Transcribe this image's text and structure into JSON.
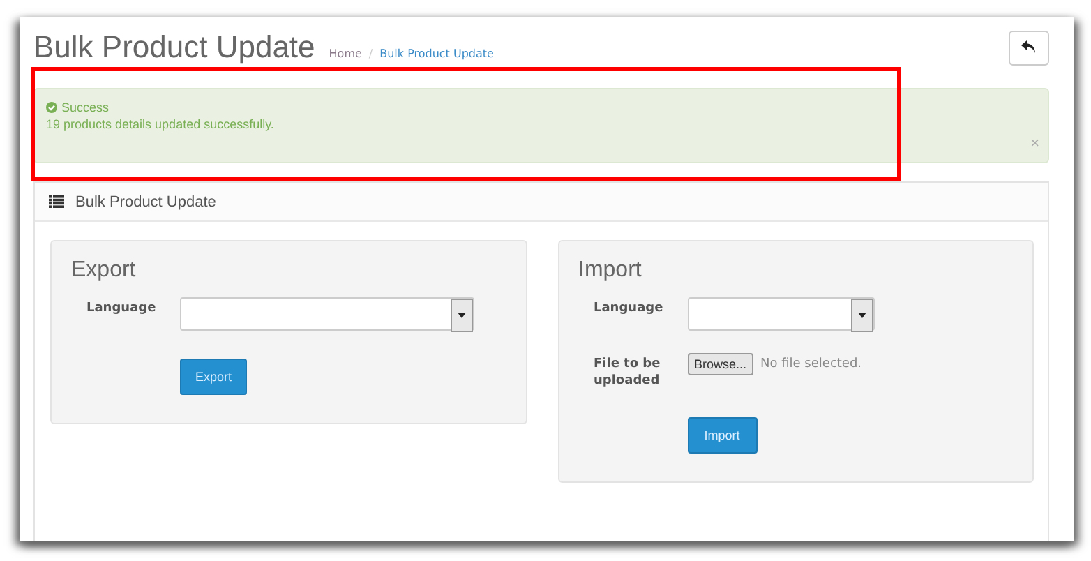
{
  "header": {
    "title": "Bulk Product Update",
    "separator": "/",
    "breadcrumbs": [
      {
        "label": "Home",
        "current": false
      },
      {
        "label": "Bulk Product Update",
        "current": true
      }
    ]
  },
  "alert": {
    "title": "Success",
    "message": "19 products details updated successfully.",
    "close": "×",
    "highlighted": true
  },
  "panel": {
    "title": "Bulk Product Update"
  },
  "export": {
    "title": "Export",
    "language_label": "Language",
    "button": "Export"
  },
  "import": {
    "title": "Import",
    "language_label": "Language",
    "file_label": "File to be uploaded",
    "browse": "Browse...",
    "file_status": "No file selected.",
    "button": "Import"
  }
}
